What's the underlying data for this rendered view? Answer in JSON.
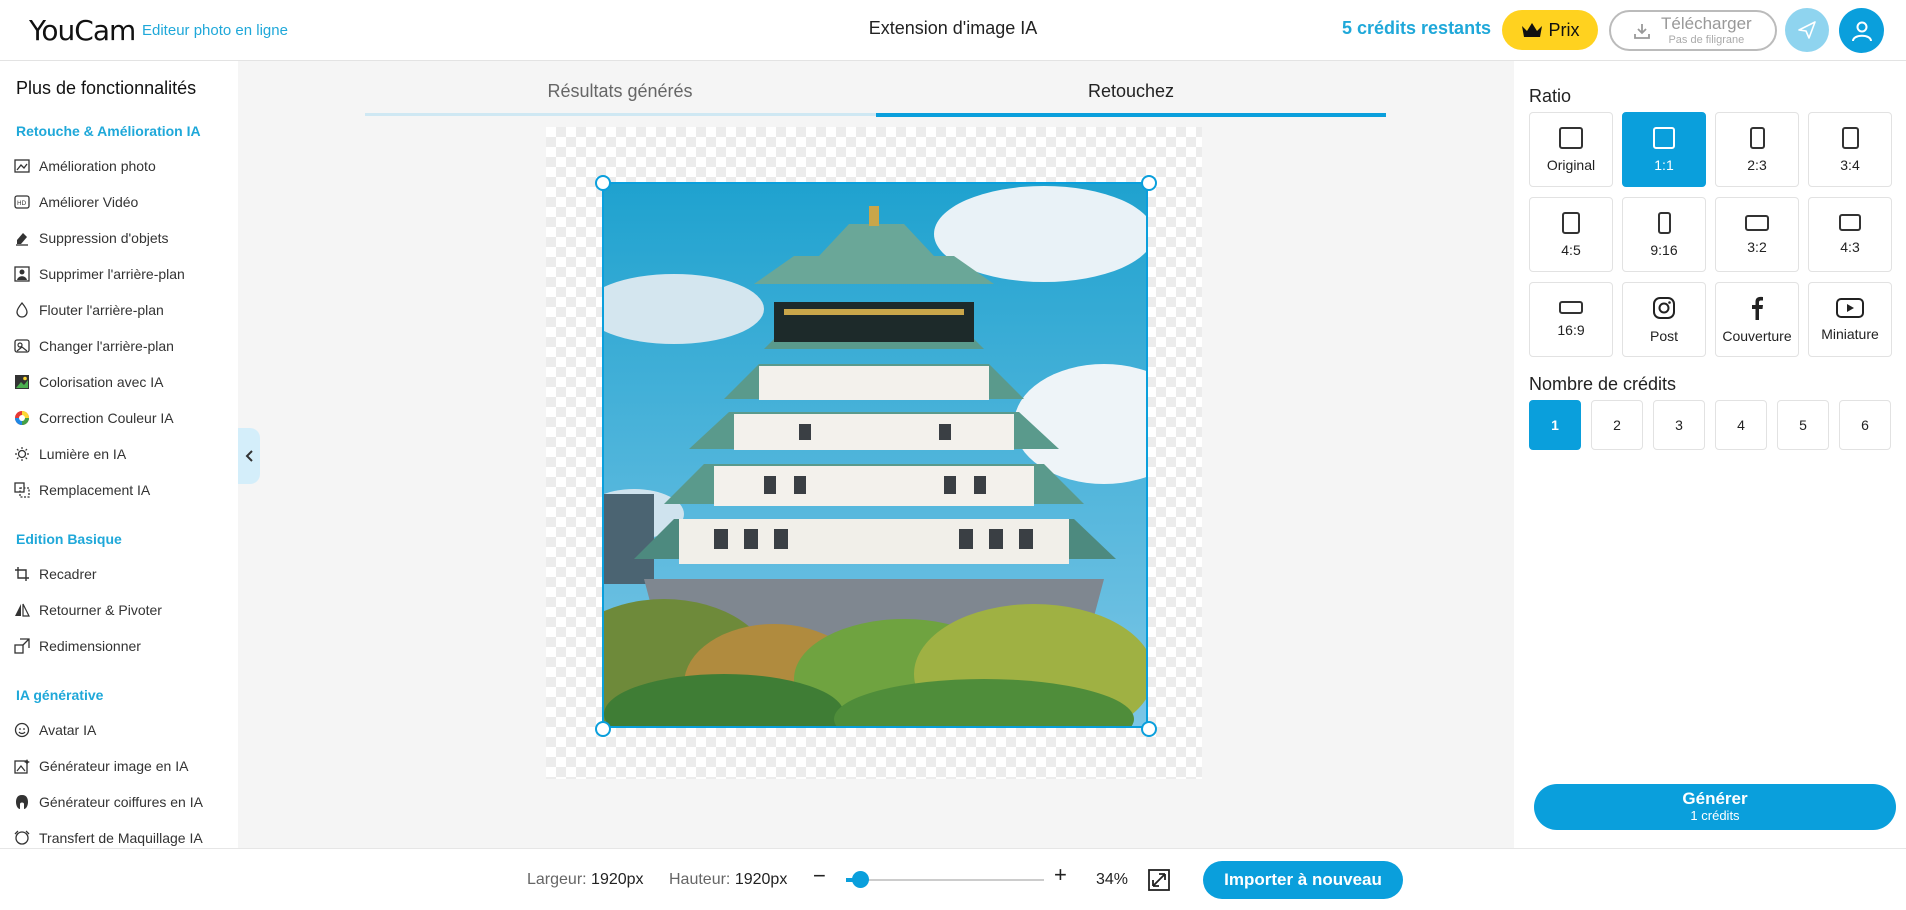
{
  "header": {
    "logo": "YouCam",
    "logo_sub": "Editeur photo en ligne",
    "title": "Extension d'image IA",
    "credits": "5 crédits restants",
    "prix_label": "Prix",
    "download_label": "Télécharger",
    "download_sub": "Pas de filigrane"
  },
  "sidebar": {
    "title": "Plus de fonctionnalités",
    "sections": [
      {
        "title": "Retouche & Amélioration IA",
        "items": [
          "Amélioration photo",
          "Améliorer Vidéo",
          "Suppression d'objets",
          "Supprimer l'arrière-plan",
          "Flouter l'arrière-plan",
          "Changer l'arrière-plan",
          "Colorisation avec IA",
          "Correction Couleur IA",
          "Lumière en IA",
          "Remplacement IA"
        ]
      },
      {
        "title": "Edition Basique",
        "items": [
          "Recadrer",
          "Retourner & Pivoter",
          "Redimensionner"
        ]
      },
      {
        "title": "IA générative",
        "items": [
          "Avatar IA",
          "Générateur image en IA",
          "Générateur coiffures en IA",
          "Transfert de Maquillage IA"
        ]
      }
    ]
  },
  "tabs": {
    "results": "Résultats générés",
    "retouch": "Retouchez"
  },
  "right_panel": {
    "ratio_title": "Ratio",
    "ratios": [
      "Original",
      "1:1",
      "2:3",
      "3:4",
      "4:5",
      "9:16",
      "3:2",
      "4:3",
      "16:9",
      "Post",
      "Couverture",
      "Miniature"
    ],
    "selected_ratio": "1:1",
    "credits_title": "Nombre de crédits",
    "credit_options": [
      "1",
      "2",
      "3",
      "4",
      "5",
      "6"
    ],
    "selected_credit": "1",
    "generate_label": "Générer",
    "generate_sub": "1 crédits"
  },
  "bottom": {
    "width_label": "Largeur:",
    "width_value": "1920px",
    "height_label": "Hauteur:",
    "height_value": "1920px",
    "zoom_minus": "−",
    "zoom_plus": "+",
    "zoom_value": "34%",
    "zoom_level": 0.34,
    "import_label": "Importer à nouveau"
  },
  "colors": {
    "accent": "#0a9fdc",
    "accent_light": "#1fa8d9",
    "prix": "#ffd21f"
  },
  "icons": [
    "crown-icon",
    "download-icon",
    "send-icon",
    "user-icon",
    "chevron-left-icon",
    "fit-screen-icon",
    "instagram-icon",
    "facebook-icon",
    "youtube-icon"
  ]
}
